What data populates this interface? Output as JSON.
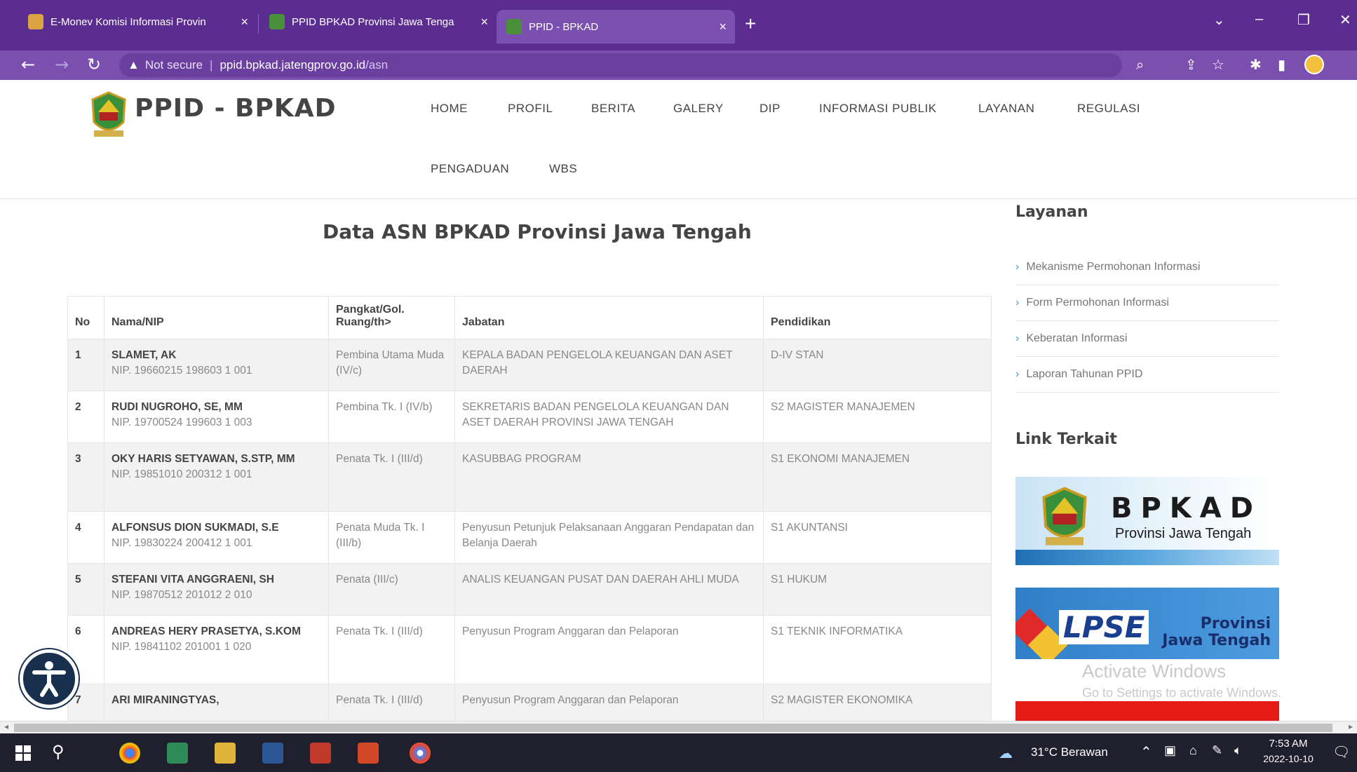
{
  "browser": {
    "tabs": [
      {
        "title": "E-Monev Komisi Informasi Provin"
      },
      {
        "title": "PPID BPKAD Provinsi Jawa Tenga"
      },
      {
        "title": "PPID - BPKAD"
      }
    ],
    "close_glyph": "×",
    "new_tab_glyph": "+",
    "not_secure_label": "Not secure",
    "url_host": "ppid.bpkad.jatengprov.go.id",
    "url_path": "/asn"
  },
  "site": {
    "title": "PPID - BPKAD",
    "menu": [
      {
        "label": "HOME"
      },
      {
        "label": "PROFIL"
      },
      {
        "label": "BERITA"
      },
      {
        "label": "GALERY"
      },
      {
        "label": "DIP"
      },
      {
        "label": "INFORMASI PUBLIK"
      },
      {
        "label": "LAYANAN"
      },
      {
        "label": "REGULASI"
      },
      {
        "label": "PENGADUAN"
      },
      {
        "label": "WBS"
      }
    ]
  },
  "main": {
    "title": "Data ASN BPKAD Provinsi Jawa Tengah",
    "table": {
      "headers": [
        "No",
        "Nama/NIP",
        "Pangkat/Gol.\nRuang/th>",
        "Jabatan",
        "Pendidikan"
      ],
      "rows": [
        {
          "no": "1",
          "name": "SLAMET, AK",
          "nip": "NIP. 19660215 198603 1 001",
          "pangkat": "Pembina Utama Muda (IV/c)",
          "jabatan": "KEPALA BADAN PENGELOLA KEUANGAN DAN ASET DAERAH",
          "pendidikan": "D-IV STAN"
        },
        {
          "no": "2",
          "name": "RUDI NUGROHO, SE, MM",
          "nip": "NIP. 19700524 199603 1 003",
          "pangkat": "Pembina Tk. I (IV/b)",
          "jabatan": "SEKRETARIS BADAN PENGELOLA KEUANGAN DAN ASET DAERAH PROVINSI JAWA TENGAH",
          "pendidikan": "S2 MAGISTER MANAJEMEN"
        },
        {
          "no": "3",
          "name": "OKY HARIS SETYAWAN, S.STP, MM",
          "nip": "NIP. 19851010 200312 1 001",
          "pangkat": "Penata Tk. I (III/d)",
          "jabatan": "KASUBBAG PROGRAM",
          "pendidikan": "S1 EKONOMI MANAJEMEN"
        },
        {
          "no": "4",
          "name": "ALFONSUS DION SUKMADI, S.E",
          "nip": "NIP. 19830224 200412 1 001",
          "pangkat": "Penata Muda Tk. I (III/b)",
          "jabatan": "Penyusun Petunjuk Pelaksanaan Anggaran Pendapatan dan Belanja Daerah",
          "pendidikan": "S1 AKUNTANSI"
        },
        {
          "no": "5",
          "name": "STEFANI VITA ANGGRAENI, SH",
          "nip": "NIP. 19870512 201012 2 010",
          "pangkat": "Penata (III/c)",
          "jabatan": "ANALIS KEUANGAN PUSAT DAN DAERAH AHLI MUDA",
          "pendidikan": "S1 HUKUM"
        },
        {
          "no": "6",
          "name": "ANDREAS HERY PRASETYA, S.KOM",
          "nip": "NIP. 19841102 201001 1 020",
          "pangkat": "Penata Tk. I (III/d)",
          "jabatan": "Penyusun Program Anggaran dan Pelaporan",
          "pendidikan": "S1 TEKNIK INFORMATIKA"
        },
        {
          "no": "7",
          "name": "ARI MIRANINGTYAS,",
          "nip": "",
          "pangkat": "Penata Tk. I (III/d)",
          "jabatan": "Penyusun Program Anggaran dan Pelaporan",
          "pendidikan": "S2 MAGISTER EKONOMIKA"
        }
      ]
    }
  },
  "sidebar": {
    "layanan_title": "Layanan",
    "layanan_items": [
      {
        "label": "Mekanisme Permohonan Informasi"
      },
      {
        "label": "Form Permohonan Informasi"
      },
      {
        "label": "Keberatan Informasi"
      },
      {
        "label": "Laporan Tahunan PPID"
      }
    ],
    "link_title": "Link Terkait",
    "banner_bpkad": {
      "big": "BPKAD",
      "sub": "Provinsi Jawa Tengah"
    },
    "banner_lpse": {
      "logo": "LPSE",
      "prov_line1": "Provinsi",
      "prov_line2": "Jawa Tengah"
    }
  },
  "watermark": {
    "line1": "Activate Windows",
    "line2": "Go to Settings to activate Windows."
  },
  "taskbar": {
    "weather": "31°C  Berawan",
    "time": "7:53 AM",
    "date": "2022-10-10"
  },
  "colors": {
    "chrome": "#5c2d91",
    "accent_link": "#3fa0d8"
  }
}
